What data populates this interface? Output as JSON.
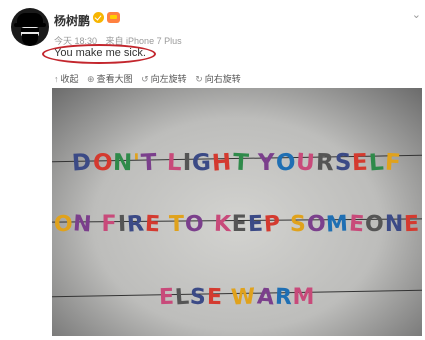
{
  "post": {
    "username": "杨树鹏",
    "time": "今天 18:30",
    "source": "来自 iPhone 7 Plus",
    "text": "You make me sick."
  },
  "toolbar": {
    "items": [
      {
        "label": "收起",
        "icon": "collapse-up-icon"
      },
      {
        "label": "查看大图",
        "icon": "zoom-icon"
      },
      {
        "label": "向左旋转",
        "icon": "rotate-left-icon"
      },
      {
        "label": "向右旋转",
        "icon": "rotate-right-icon"
      }
    ]
  },
  "photo": {
    "line1": "DON'T LIGHT YOURSELF",
    "line2": "ON FIRE TO KEEP SOMEONE",
    "line3": "ELSE WARM"
  },
  "colors": {
    "annotation": "#c3262d",
    "verified": "#f7b500"
  }
}
